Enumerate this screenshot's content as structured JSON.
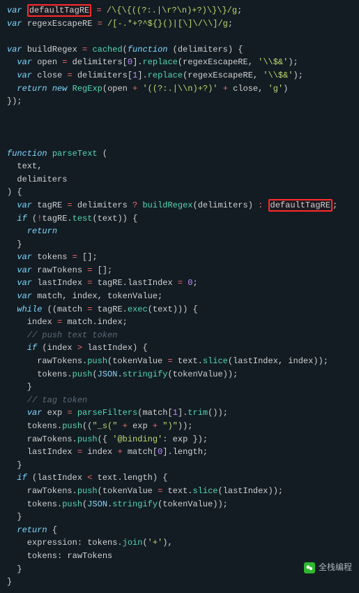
{
  "code": {
    "l1_kw": "var",
    "l1_hl": "defaultTagRE",
    "l1_op": "=",
    "l1_rx": "/\\{\\{((?:.|\\r?\\n)+?)\\}\\}/g",
    "l1_end": ";",
    "l2_kw": "var",
    "l2_id": "regexEscapeRE",
    "l2_op": "=",
    "l2_rx": "/[-.*+?^${}()|[\\]\\/\\\\]/g",
    "l2_end": ";",
    "l4_kw": "var",
    "l4_id": "buildRegex",
    "l4_op": "=",
    "l4_fn": "cached",
    "l4_p1": "(",
    "l4_kw2": "function",
    "l4_p2": " (",
    "l4_arg": "delimiters",
    "l4_p3": ") {",
    "l5_kw": "var",
    "l5_id": "open",
    "l5_op1": "=",
    "l5_d": "delimiters",
    "l5_br1": "[",
    "l5_n0": "0",
    "l5_br2": "].",
    "l5_fn": "replace",
    "l5_p1": "(",
    "l5_a1": "regexEscapeRE",
    "l5_c": ", ",
    "l5_s": "'\\\\$&'",
    "l5_p2": ");",
    "l6_kw": "var",
    "l6_id": "close",
    "l6_op1": "=",
    "l6_d": "delimiters",
    "l6_br1": "[",
    "l6_n1": "1",
    "l6_br2": "].",
    "l6_fn": "replace",
    "l6_p1": "(",
    "l6_a1": "regexEscapeRE",
    "l6_c": ", ",
    "l6_s": "'\\\\$&'",
    "l6_p2": ");",
    "l7_kw": "return",
    "l7_new": "new",
    "l7_cl": "RegExp",
    "l7_p1": "(",
    "l7_o": "open",
    "l7_op": " + ",
    "l7_s": "'((?:.|\\\\n)+?)'",
    "l7_op2": " + ",
    "l7_c": "close",
    "l7_cm": ", ",
    "l7_g": "'g'",
    "l7_p2": ")",
    "l8": "});",
    "l11_kw": "function",
    "l11_fn": "parseText",
    "l11_p": " (",
    "l12": "  text,",
    "l13": "  delimiters",
    "l14": ") {",
    "l15_kw": "var",
    "l15_id": "tagRE",
    "l15_op": "=",
    "l15_d": "delimiters",
    "l15_q": " ? ",
    "l15_fn": "buildRegex",
    "l15_p1": "(",
    "l15_a": "delimiters",
    "l15_p2": ")",
    "l15_col": " : ",
    "l15_hl": "defaultTagRE",
    "l15_sc": ";",
    "l16_kw": "if",
    "l16_p1": " (",
    "l16_not": "!",
    "l16_t": "tagRE",
    "l16_d": ".",
    "l16_fn": "test",
    "l16_p2": "(",
    "l16_a": "text",
    "l16_p3": ")) {",
    "l17_kw": "return",
    "l18": "  }",
    "l19_kw": "var",
    "l19_id": "tokens",
    "l19_op": "=",
    "l19_v": " [];",
    "l20_kw": "var",
    "l20_id": "rawTokens",
    "l20_op": "=",
    "l20_v": " [];",
    "l21_kw": "var",
    "l21_id": "lastIndex",
    "l21_op": "=",
    "l21_t": "tagRE",
    "l21_d": ".",
    "l21_p": "lastIndex",
    "l21_op2": "=",
    "l21_n": "0",
    "l21_e": ";",
    "l22_kw": "var",
    "l22_v": " match, index, tokenValue;",
    "l23_kw": "while",
    "l23_p1": " ((",
    "l23_m": "match",
    "l23_op": " = ",
    "l23_t": "tagRE",
    "l23_d": ".",
    "l23_fn": "exec",
    "l23_p2": "(",
    "l23_a": "text",
    "l23_p3": "))) {",
    "l24": "    index ",
    "l24_op": "=",
    "l24_r": " match",
    "l24_d": ".",
    "l24_p": "index;",
    "l25_cmt": "// push text token",
    "l26_kw": "if",
    "l26_p": " (index ",
    "l26_op": ">",
    "l26_r": " lastIndex) {",
    "l27": "      rawTokens.",
    "l27_fn": "push",
    "l27_p1": "(tokenValue ",
    "l27_op": "=",
    "l27_t": " text.",
    "l27_fn2": "slice",
    "l27_p2": "(lastIndex, index));",
    "l28": "      tokens.",
    "l28_fn": "push",
    "l28_p1": "(",
    "l28_j": "JSON",
    "l28_d": ".",
    "l28_fn2": "stringify",
    "l28_p2": "(tokenValue));",
    "l29": "    }",
    "l30_cmt": "// tag token",
    "l31_kw": "var",
    "l31_id": "exp",
    "l31_op": "=",
    "l31_fn": " parseFilters",
    "l31_p1": "(match[",
    "l31_n": "1",
    "l31_p2": "].",
    "l31_fn2": "trim",
    "l31_p3": "());",
    "l32": "    tokens.",
    "l32_fn": "push",
    "l32_p1": "((",
    "l32_s1": "\"_s(\"",
    "l32_op1": " + ",
    "l32_e": "exp",
    "l32_op2": " + ",
    "l32_s2": "\")\"",
    "l32_p2": "));",
    "l33": "    rawTokens.",
    "l33_fn": "push",
    "l33_p1": "({ ",
    "l33_s": "'@binding'",
    "l33_c": ": exp });",
    "l34": "    lastIndex ",
    "l34_op": "=",
    "l34_r": " index ",
    "l34_op2": "+",
    "l34_m": " match[",
    "l34_n": "0",
    "l34_p": "].",
    "l34_l": "length;",
    "l35": "  }",
    "l36_kw": "if",
    "l36_p": " (lastIndex ",
    "l36_op": "<",
    "l36_r": " text.",
    "l36_l": "length) {",
    "l37": "    rawTokens.",
    "l37_fn": "push",
    "l37_p1": "(tokenValue ",
    "l37_op": "=",
    "l37_t": " text.",
    "l37_fn2": "slice",
    "l37_p2": "(lastIndex));",
    "l38": "    tokens.",
    "l38_fn": "push",
    "l38_p1": "(",
    "l38_j": "JSON",
    "l38_d": ".",
    "l38_fn2": "stringify",
    "l38_p2": "(tokenValue));",
    "l39": "  }",
    "l40_kw": "return",
    "l40_p": " {",
    "l41": "    expression: tokens.",
    "l41_fn": "join",
    "l41_p1": "(",
    "l41_s": "'+'",
    "l41_p2": "),",
    "l42": "    tokens: rawTokens",
    "l43": "  }",
    "l44": "}"
  },
  "watermark": "全栈编程"
}
